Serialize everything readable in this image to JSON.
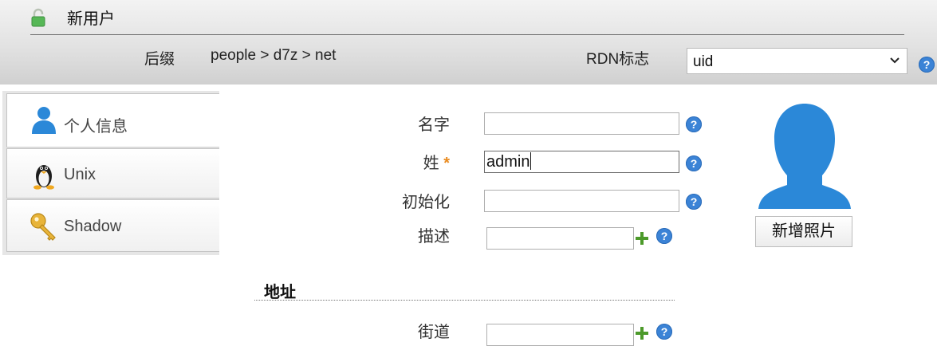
{
  "header": {
    "title": "新用户",
    "suffix_label": "后缀",
    "suffix_value": "people > d7z > net",
    "rdn_label": "RDN标志",
    "rdn_selected": "uid",
    "help_glyph": "?",
    "title_icon": "unlocked-padlock-icon"
  },
  "tabs": [
    {
      "label": "个人信息",
      "icon": "person-icon",
      "active": true
    },
    {
      "label": "Unix",
      "icon": "penguin-icon",
      "active": false
    },
    {
      "label": "Shadow",
      "icon": "key-icon",
      "active": false
    }
  ],
  "form": {
    "first_name": {
      "label": "名字",
      "value": ""
    },
    "last_name": {
      "label": "姓",
      "required_mark": "*",
      "value": "admin"
    },
    "initials": {
      "label": "初始化",
      "value": ""
    },
    "description": {
      "label": "描述",
      "value": ""
    },
    "add_photo_button": "新增照片"
  },
  "address": {
    "section_title": "地址",
    "street": {
      "label": "街道",
      "value": ""
    }
  },
  "colors": {
    "accent_blue": "#3b83d6",
    "avatar_blue": "#2b88d8",
    "required_orange": "#e98a1e",
    "plus_green": "#4c9a2a"
  }
}
